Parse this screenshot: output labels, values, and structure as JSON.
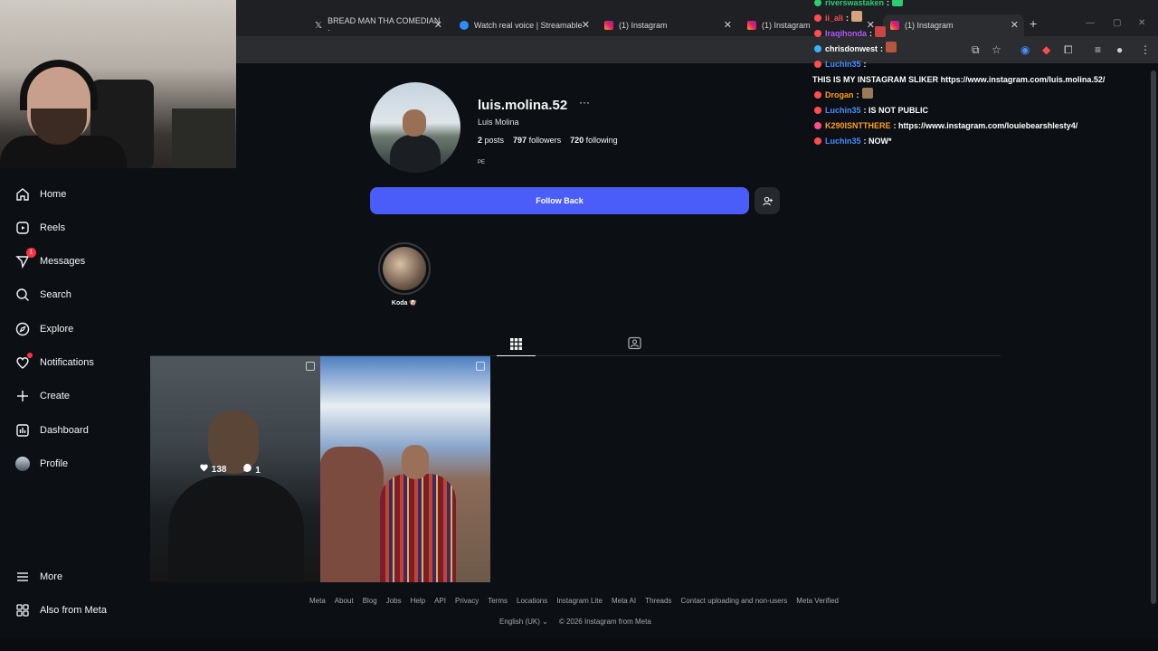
{
  "browser": {
    "tabs": [
      {
        "label": "BREAD MAN THA COMEDIAN ·",
        "icon": "x-logo-icon"
      },
      {
        "label": "Watch real voice | Streamable",
        "icon": "streamable-icon"
      },
      {
        "label": "(1) Instagram",
        "icon": "instagram-icon"
      },
      {
        "label": "(1) Instagram",
        "icon": "instagram-icon"
      },
      {
        "label": "(1) Instagram",
        "icon": "instagram-icon"
      }
    ]
  },
  "sidebar": {
    "items": [
      {
        "label": "Home",
        "icon": "home-icon"
      },
      {
        "label": "Reels",
        "icon": "reels-icon"
      },
      {
        "label": "Messages",
        "icon": "messages-icon",
        "badge": "1"
      },
      {
        "label": "Search",
        "icon": "search-icon"
      },
      {
        "label": "Explore",
        "icon": "explore-icon"
      },
      {
        "label": "Notifications",
        "icon": "heart-icon"
      },
      {
        "label": "Create",
        "icon": "plus-icon"
      },
      {
        "label": "Dashboard",
        "icon": "dashboard-icon"
      },
      {
        "label": "Profile",
        "icon": "avatar-icon"
      },
      {
        "label": "More",
        "icon": "menu-icon"
      },
      {
        "label": "Also from Meta",
        "icon": "meta-apps-icon"
      }
    ]
  },
  "profile": {
    "username": "luis.molina.52",
    "more": "···",
    "full_name": "Luis Molina",
    "posts_count": "2",
    "posts_label": "posts",
    "followers_count": "797",
    "followers_label": "followers",
    "following_count": "720",
    "following_label": "following",
    "pronoun": "PE",
    "follow_back_label": "Follow Back",
    "highlight_label": "Koda 🐶"
  },
  "posts": [
    {
      "likes": "138",
      "comments": "1"
    },
    {
      "likes": "",
      "comments": ""
    }
  ],
  "footer": {
    "links": [
      "Meta",
      "About",
      "Blog",
      "Jobs",
      "Help",
      "API",
      "Privacy",
      "Terms",
      "Locations",
      "Instagram Lite",
      "Meta AI",
      "Threads",
      "Contact uploading and non-users",
      "Meta Verified"
    ],
    "language": "English (UK)",
    "copyright": "© 2026 Instagram from Meta"
  },
  "chat": [
    {
      "name": "riverswastaken",
      "text": "",
      "color": "#2ecc71"
    },
    {
      "name": "ii_ali",
      "text": "",
      "color": "#ff4d4d"
    },
    {
      "name": "Iraqihonda",
      "text": "",
      "color": "#b45cff"
    },
    {
      "name": "chrisdonwest",
      "text": "",
      "color": "#ffffff"
    },
    {
      "name": "Luchin35",
      "text": "THIS IS MY INSTAGRAM SLIKER https://www.instagram.com/luis.molina.52/",
      "color": "#4a8cff"
    },
    {
      "name": "Drogan",
      "text": "",
      "color": "#ff9f1c"
    },
    {
      "name": "Luchin35",
      "text": "IS NOT PUBLIC",
      "color": "#4a8cff"
    },
    {
      "name": "K290ISNTTHERE",
      "text": "https://www.instagram.com/louiebearshlesty4/",
      "color": "#ff9f1c"
    },
    {
      "name": "Luchin35",
      "text": "NOW*",
      "color": "#4a8cff"
    }
  ]
}
